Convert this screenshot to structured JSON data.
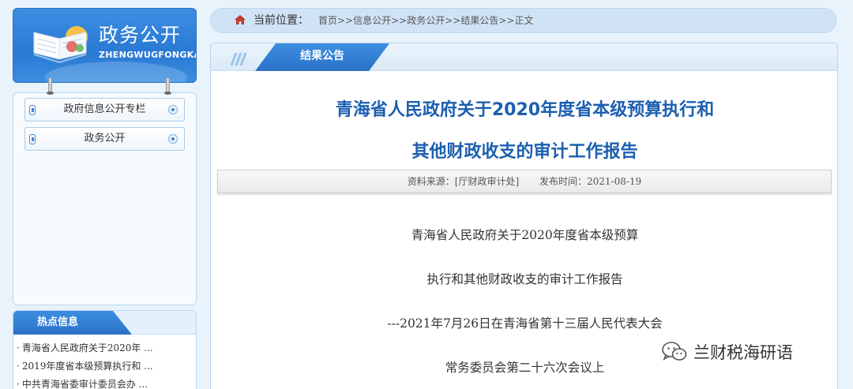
{
  "logo": {
    "title": "政务公开",
    "subtitle": "ZHENGWUGFONGKAI"
  },
  "sidebar": {
    "items": [
      {
        "label": "政府信息公开专栏"
      },
      {
        "label": "政务公开"
      }
    ]
  },
  "hot": {
    "title": "热点信息",
    "items": [
      "青海省人民政府关于2020年 ...",
      "2019年度省本级预算执行和 ...",
      "中共青海省委审计委员会办 ..."
    ]
  },
  "breadcrumb": {
    "label": "当前位置：",
    "path": "首页>>信息公开>>政务公开>>结果公告>>正文"
  },
  "content": {
    "tab": "结果公告",
    "title_line1": "青海省人民政府关于2020年度省本级预算执行和",
    "title_line2": "其他财政收支的审计工作报告",
    "source": "资料来源：[厅财政审计处]",
    "date": "发布时间：2021-08-19",
    "body": [
      "青海省人民政府关于2020年度省本级预算",
      "执行和其他财政收支的审计工作报告",
      "---2021年7月26日在青海省第十三届人民代表大会",
      "常务委员会第二十六次会议上"
    ]
  },
  "watermark": {
    "text": "兰财税海研语",
    "icon": "wechat-icon"
  },
  "colors": {
    "accent": "#2a79d4",
    "title": "#1c5fb0",
    "background": "#e9f3fb"
  }
}
